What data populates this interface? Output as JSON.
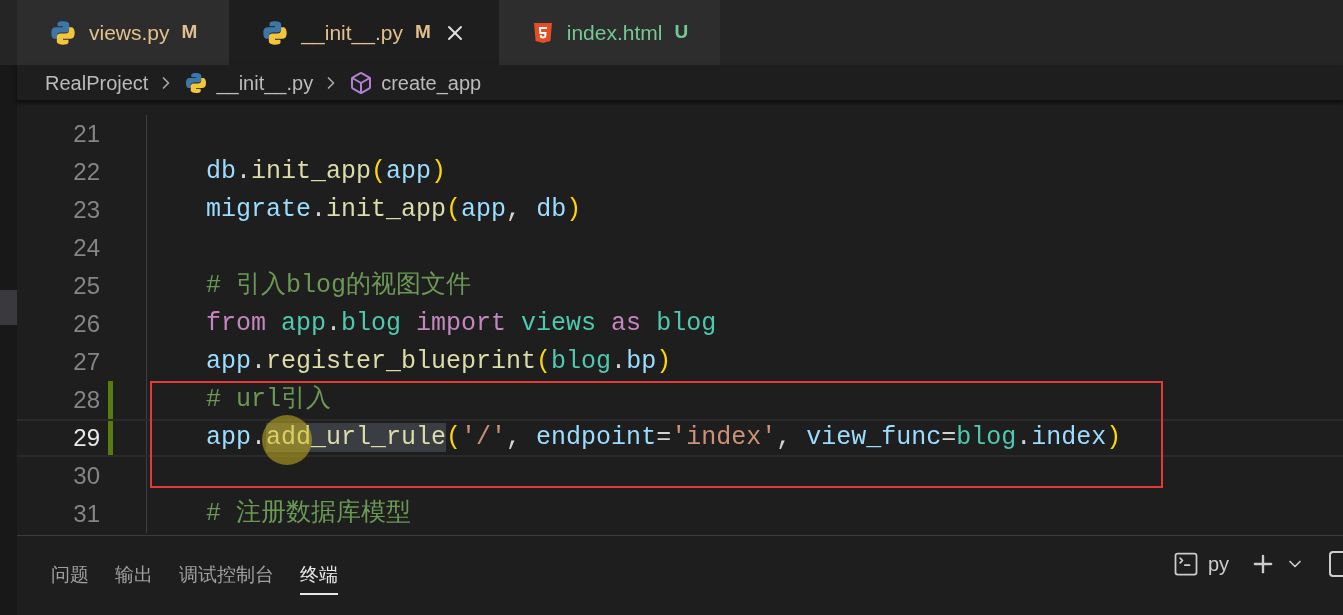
{
  "tabs": [
    {
      "label": "views.py",
      "badge": "M",
      "color": "#e2c08d",
      "kind": "python",
      "selected": false
    },
    {
      "label": "__init__.py",
      "badge": "M",
      "color": "#e2c08d",
      "kind": "python",
      "selected": true
    },
    {
      "label": "index.html",
      "badge": "U",
      "color": "#73c991",
      "kind": "html",
      "selected": false
    }
  ],
  "breadcrumb": [
    {
      "label": "RealProject",
      "kind": "folder"
    },
    {
      "label": "__init__.py",
      "kind": "python"
    },
    {
      "label": "create_app",
      "kind": "symbol"
    }
  ],
  "editor": {
    "lines": [
      {
        "number": "21",
        "modified": false,
        "current": false
      },
      {
        "number": "22",
        "modified": false,
        "current": false,
        "tokens": [
          {
            "text": "db",
            "kind": "var"
          },
          {
            "text": ".",
            "kind": "plain"
          },
          {
            "text": "init_app",
            "kind": "func"
          },
          {
            "text": "(",
            "kind": "paren"
          },
          {
            "text": "app",
            "kind": "var"
          },
          {
            "text": ")",
            "kind": "paren"
          }
        ]
      },
      {
        "number": "23",
        "modified": false,
        "current": false,
        "tokens": [
          {
            "text": "migrate",
            "kind": "var"
          },
          {
            "text": ".",
            "kind": "plain"
          },
          {
            "text": "init_app",
            "kind": "func"
          },
          {
            "text": "(",
            "kind": "paren"
          },
          {
            "text": "app",
            "kind": "var"
          },
          {
            "text": ", ",
            "kind": "plain"
          },
          {
            "text": "db",
            "kind": "var"
          },
          {
            "text": ")",
            "kind": "paren"
          }
        ]
      },
      {
        "number": "24",
        "modified": false,
        "current": false
      },
      {
        "number": "25",
        "modified": false,
        "current": false,
        "tokens": [
          {
            "text": "# 引入blog的视图文件",
            "kind": "comment"
          }
        ]
      },
      {
        "number": "26",
        "modified": false,
        "current": false,
        "tokens": [
          {
            "text": "from ",
            "kind": "keyword"
          },
          {
            "text": "app",
            "kind": "module"
          },
          {
            "text": ".",
            "kind": "plain"
          },
          {
            "text": "blog ",
            "kind": "module"
          },
          {
            "text": "import ",
            "kind": "keyword"
          },
          {
            "text": "views ",
            "kind": "module"
          },
          {
            "text": "as ",
            "kind": "keyword"
          },
          {
            "text": "blog",
            "kind": "module"
          }
        ]
      },
      {
        "number": "27",
        "modified": false,
        "current": false,
        "tokens": [
          {
            "text": "app",
            "kind": "var"
          },
          {
            "text": ".",
            "kind": "plain"
          },
          {
            "text": "register_blueprint",
            "kind": "func"
          },
          {
            "text": "(",
            "kind": "paren"
          },
          {
            "text": "blog",
            "kind": "module"
          },
          {
            "text": ".",
            "kind": "plain"
          },
          {
            "text": "bp",
            "kind": "var"
          },
          {
            "text": ")",
            "kind": "paren"
          }
        ]
      },
      {
        "number": "28",
        "modified": true,
        "current": false,
        "tokens": [
          {
            "text": "# url引入",
            "kind": "comment"
          }
        ]
      },
      {
        "number": "29",
        "modified": true,
        "current": true,
        "tokens": [
          {
            "text": "app",
            "kind": "var"
          },
          {
            "text": ".",
            "kind": "plain"
          },
          {
            "text": "add_url_rule",
            "kind": "func",
            "selected": true
          },
          {
            "text": "(",
            "kind": "paren"
          },
          {
            "text": "'/'",
            "kind": "string"
          },
          {
            "text": ", ",
            "kind": "plain"
          },
          {
            "text": "endpoint",
            "kind": "var"
          },
          {
            "text": "=",
            "kind": "plain"
          },
          {
            "text": "'index'",
            "kind": "string"
          },
          {
            "text": ", ",
            "kind": "plain"
          },
          {
            "text": "view_func",
            "kind": "var"
          },
          {
            "text": "=",
            "kind": "plain"
          },
          {
            "text": "blog",
            "kind": "module"
          },
          {
            "text": ".",
            "kind": "plain"
          },
          {
            "text": "index",
            "kind": "var"
          },
          {
            "text": ")",
            "kind": "paren"
          }
        ]
      },
      {
        "number": "30",
        "modified": false,
        "current": false
      },
      {
        "number": "31",
        "modified": false,
        "current": false,
        "tokens": [
          {
            "text": "# 注册数据库模型",
            "kind": "comment"
          }
        ]
      }
    ]
  },
  "panel": {
    "tabs": [
      {
        "label": "问题",
        "selected": false
      },
      {
        "label": "输出",
        "selected": false
      },
      {
        "label": "调试控制台",
        "selected": false
      },
      {
        "label": "终端",
        "selected": true
      }
    ],
    "terminal": {
      "shell": "py"
    }
  }
}
